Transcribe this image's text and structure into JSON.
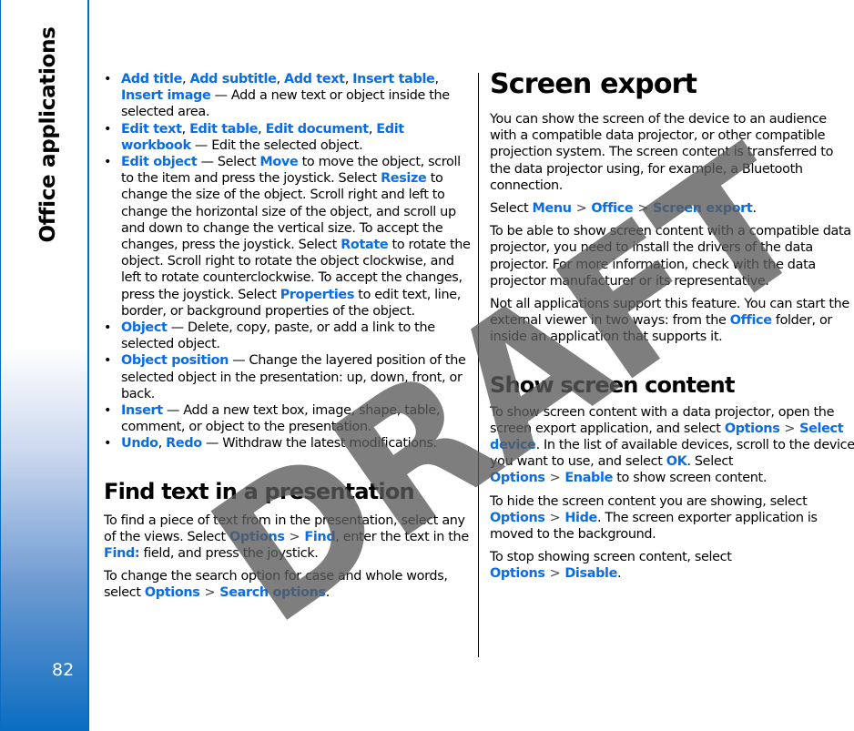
{
  "sidebar": {
    "section_title": "Office applications",
    "page_number": "82"
  },
  "left": {
    "items": [
      {
        "links": [
          "Add title",
          "Add subtitle",
          "Add text",
          "Insert table",
          "Insert image"
        ],
        "text": " — Add a new text or object inside the selected area."
      },
      {
        "links": [
          "Edit text",
          "Edit table",
          "Edit document",
          "Edit workbook"
        ],
        "text": " — Edit the selected object."
      },
      {
        "lead": "Edit object",
        "t1": " — Select ",
        "move": "Move",
        "t2": " to move the object, scroll to the item and press the joystick. Select ",
        "resize": "Resize",
        "t3": " to change the size of the object. Scroll right and left to change the horizontal size of the object, and scroll up and down to change the vertical size. To accept the changes, press the joystick. Select ",
        "rotate": "Rotate",
        "t4": " to rotate the object. Scroll right to rotate the object clockwise, and left to rotate counterclockwise. To accept the changes, press the joystick. Select ",
        "properties": "Properties",
        "t5": " to edit text, line, border, or background properties of the object."
      },
      {
        "lead": "Object",
        "text": " — Delete, copy, paste, or add a link to the selected object."
      },
      {
        "lead": "Object position",
        "text": " — Change the layered position of the selected object in the presentation: up, down, front, or back."
      },
      {
        "lead": "Insert",
        "text": " — Add a new text box, image, shape, table, comment, or object to the presentation."
      },
      {
        "links": [
          "Undo",
          "Redo"
        ],
        "text": " — Withdraw the latest modifications."
      }
    ],
    "find_heading": "Find text in a presentation",
    "find_p1": {
      "t1": "To find a piece of text from in the presentation, select any of the views. Select ",
      "options": "Options",
      "find": "Find",
      "t2": ", enter the text in the ",
      "find_field": "Find:",
      "t3": " field, and press the joystick."
    },
    "find_p2": {
      "t1": "To change the search option for case and whole words, select ",
      "options": "Options",
      "search_options": "Search options",
      "t2": "."
    }
  },
  "right": {
    "heading": "Screen export",
    "p1": "You can show the screen of the device to an audience with a compatible data projector, or other compatible projection system. The screen content is transferred to the data projector using, for example, a Bluetooth connection.",
    "p2": {
      "t1": "Select ",
      "menu": "Menu",
      "office": "Office",
      "screen_export": "Screen export",
      "t2": "."
    },
    "p3": "To be able to show screen content with a compatible data projector, you need to install the drivers of the data projector. For more information, check with the data projector manufacturer or its representative.",
    "p4": {
      "t1": "Not all applications support this feature. You can start the external viewer in two ways: from the ",
      "office": "Office",
      "t2": " folder, or inside an application that supports it."
    },
    "subheading": "Show screen content",
    "p5": {
      "t1": "To show screen content with a data projector, open the screen export application, and select ",
      "options": "Options",
      "select_device": "Select device",
      "t2": ". In the list of available devices, scroll to the device you want to use, and select ",
      "ok": "OK",
      "t3": ". Select ",
      "options2": "Options",
      "enable": "Enable",
      "t4": " to show screen content."
    },
    "p6": {
      "t1": "To hide the screen content you are showing, select ",
      "options": "Options",
      "hide": "Hide",
      "t2": ". The screen exporter application is moved to the background."
    },
    "p7": {
      "t1": "To stop showing screen content, select ",
      "options": "Options",
      "disable": "Disable",
      "t2": "."
    }
  },
  "symbols": {
    "bullet": "•",
    "separator": ">",
    "comma": ", "
  },
  "watermark": "DRAFT",
  "colors": {
    "link": "#0a6de6",
    "sidebar_border": "#0a6cc0"
  }
}
